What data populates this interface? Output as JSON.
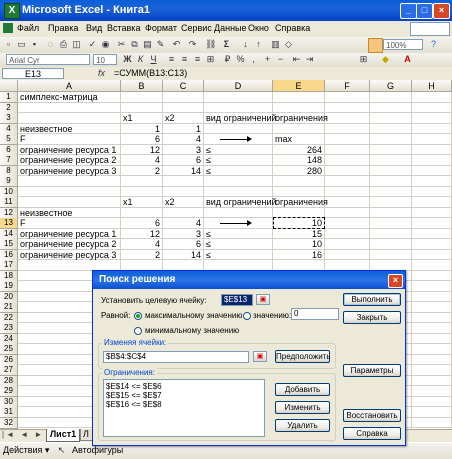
{
  "window": {
    "title": "Microsoft Excel - Книга1",
    "app_icon": "X"
  },
  "menu": [
    "Файл",
    "Правка",
    "Вид",
    "Вставка",
    "Формат",
    "Сервис",
    "Данные",
    "Окно",
    "Справка"
  ],
  "toolbar": {
    "zoom": "100%",
    "font": "Arial Cyr",
    "size": "10"
  },
  "formula_bar": {
    "name_box": "E13",
    "fx": "fx",
    "formula": "=СУММ(B13:C13)"
  },
  "columns": [
    "A",
    "B",
    "C",
    "D",
    "E",
    "F",
    "G",
    "H"
  ],
  "rows": [
    "1",
    "2",
    "3",
    "4",
    "5",
    "6",
    "7",
    "8",
    "9",
    "10",
    "11",
    "12",
    "13",
    "14",
    "15",
    "16",
    "17",
    "18",
    "19",
    "20",
    "21",
    "22",
    "23",
    "24",
    "25",
    "26",
    "27",
    "28",
    "29",
    "30",
    "31",
    "32"
  ],
  "cells": {
    "A1": "симплекс-матрица",
    "B3": "x1",
    "C3": "x2",
    "D3": "вид ограничений",
    "E3": "ограничения",
    "A4": "неизвестное",
    "B4": "1",
    "C4": "1",
    "A5": "F",
    "B5": "6",
    "C5": "4",
    "E5": "max",
    "A6": "ограничение ресурса 1",
    "B6": "12",
    "C6": "3",
    "D6": "≤",
    "E6": "264",
    "A7": "ограничение ресурса 2",
    "B7": "4",
    "C7": "6",
    "D7": "≤",
    "E7": "148",
    "A8": "ограничение ресурса 3",
    "B8": "2",
    "C8": "14",
    "D8": "≤",
    "E8": "280",
    "B11": "x1",
    "C11": "x2",
    "D11": "вид ограничений",
    "E11": "ограничения",
    "A12": "неизвестное",
    "A13": "F",
    "B13": "6",
    "C13": "4",
    "E13": "10",
    "A14": "ограничение ресурса 1",
    "B14": "12",
    "C14": "3",
    "D14": "≤",
    "E14": "15",
    "A15": "ограничение ресурса 2",
    "B15": "4",
    "C15": "6",
    "D15": "≤",
    "E15": "10",
    "A16": "ограничение ресурса 3",
    "B16": "2",
    "C16": "14",
    "D16": "≤",
    "E16": "16"
  },
  "sheet_tabs": {
    "active": "Лист1",
    "next": "Л",
    "nav": "|◄ ◄ ► ►|"
  },
  "drawing_toolbar": {
    "actions": "Действия ▾",
    "autoshapes": "Автофигуры"
  },
  "dialog": {
    "title": "Поиск решения",
    "target_label": "Установить целевую ячейку:",
    "target_value": "$E$13",
    "equal_label": "Равной:",
    "opt_max": "максимальному значению",
    "opt_value": "значению:",
    "value_field": "0",
    "opt_min": "минимальному значению",
    "changing_title": "Изменяя ячейки:",
    "changing_value": "$B$4:$C$4",
    "constraints_title": "Ограничения:",
    "constraints": [
      "$E$14 <= $E$6",
      "$E$15 <= $E$7",
      "$E$16 <= $E$8"
    ],
    "btn_solve": "Выполнить",
    "btn_close": "Закрыть",
    "btn_guess": "Предположить",
    "btn_params": "Параметры",
    "btn_add": "Добавить",
    "btn_change": "Изменить",
    "btn_delete": "Удалить",
    "btn_reset": "Восстановить",
    "btn_help": "Справка",
    "close_glyph": "×"
  },
  "colors": {
    "titlebar": "#0a5fd6",
    "selection": "#f8d88a"
  }
}
